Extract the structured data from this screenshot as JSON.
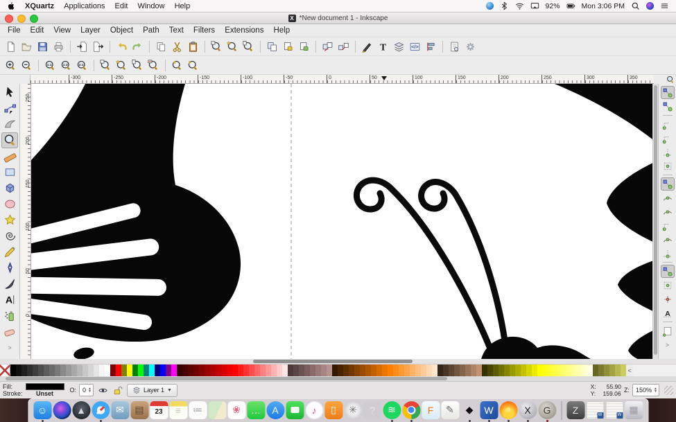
{
  "macos_menubar": {
    "app_name": "XQuartz",
    "items": [
      "Applications",
      "Edit",
      "Window",
      "Help"
    ],
    "status": {
      "battery_pct": "92%",
      "clock": "Mon 3:06 PM"
    },
    "status_icons": [
      {
        "type": "orb",
        "name": "helper-app-icon"
      },
      {
        "type": "svg",
        "icon": "bt",
        "name": "bluetooth-icon"
      },
      {
        "type": "svg",
        "icon": "wifi",
        "name": "wifi-icon"
      },
      {
        "type": "svg",
        "icon": "display",
        "name": "airplay-display-icon"
      },
      {
        "type": "text",
        "key": "battery_pct",
        "name": "battery-percent"
      },
      {
        "type": "svg",
        "icon": "battery",
        "name": "battery-icon"
      },
      {
        "type": "text",
        "key": "clock",
        "name": "menu-clock"
      },
      {
        "type": "svg",
        "icon": "search",
        "name": "spotlight-icon"
      },
      {
        "type": "siri",
        "name": "siri-icon"
      },
      {
        "type": "svg",
        "icon": "list",
        "name": "notification-center-icon"
      }
    ]
  },
  "window": {
    "title": "*New document 1 - Inkscape"
  },
  "menu": {
    "items": [
      "File",
      "Edit",
      "View",
      "Layer",
      "Object",
      "Path",
      "Text",
      "Filters",
      "Extensions",
      "Help"
    ]
  },
  "commands_toolbar": [
    {
      "name": "new-document",
      "icon": "doc-new"
    },
    {
      "name": "open-document",
      "icon": "folder-open"
    },
    {
      "name": "save-document",
      "icon": "save"
    },
    {
      "name": "print",
      "icon": "print"
    },
    {
      "sep": true
    },
    {
      "name": "import",
      "icon": "import"
    },
    {
      "name": "export",
      "icon": "export"
    },
    {
      "sep": true
    },
    {
      "name": "undo",
      "icon": "undo"
    },
    {
      "name": "redo",
      "icon": "redo"
    },
    {
      "sep": true
    },
    {
      "name": "copy",
      "icon": "copy"
    },
    {
      "name": "cut",
      "icon": "cut"
    },
    {
      "name": "paste",
      "icon": "paste"
    },
    {
      "sep": true
    },
    {
      "name": "zoom-to-selection",
      "icon": "zoom-sel"
    },
    {
      "name": "zoom-to-drawing",
      "icon": "zoom-draw"
    },
    {
      "name": "zoom-to-page",
      "icon": "zoom-page"
    },
    {
      "sep": true
    },
    {
      "name": "duplicate",
      "icon": "duplicate"
    },
    {
      "name": "create-clone",
      "icon": "clone"
    },
    {
      "name": "unlink-clone",
      "icon": "unlink-clone"
    },
    {
      "sep": true
    },
    {
      "name": "group-objects",
      "icon": "group"
    },
    {
      "name": "ungroup-objects",
      "icon": "ungroup"
    },
    {
      "sep": true
    },
    {
      "name": "fill-and-stroke-dialog",
      "icon": "fill-stroke"
    },
    {
      "name": "text-dialog",
      "icon": "text-dlg"
    },
    {
      "name": "layers-dialog",
      "icon": "layers"
    },
    {
      "name": "xml-editor",
      "icon": "xml"
    },
    {
      "name": "align-distribute-dialog",
      "icon": "align"
    },
    {
      "sep": true
    },
    {
      "name": "document-properties",
      "icon": "doc-props"
    },
    {
      "name": "preferences",
      "icon": "prefs"
    }
  ],
  "zoom_toolbar": [
    {
      "name": "zoom-in",
      "icon": "zoom-in"
    },
    {
      "name": "zoom-out",
      "icon": "zoom-out"
    },
    {
      "sep": true
    },
    {
      "name": "zoom-1-1",
      "icon": "z11"
    },
    {
      "name": "zoom-1-2",
      "icon": "z12"
    },
    {
      "name": "zoom-2-1",
      "icon": "z21"
    },
    {
      "sep": true
    },
    {
      "name": "zoom-to-selection",
      "icon": "zoom-sel"
    },
    {
      "name": "zoom-to-drawing",
      "icon": "zoom-draw"
    },
    {
      "name": "zoom-to-page",
      "icon": "zoom-page"
    },
    {
      "name": "zoom-page-width",
      "icon": "zoom-width"
    },
    {
      "sep": true
    },
    {
      "name": "zoom-previous",
      "icon": "zoom-prev"
    },
    {
      "name": "zoom-next",
      "icon": "zoom-next"
    }
  ],
  "toolbox": [
    {
      "name": "selector-tool",
      "icon": "tool-select"
    },
    {
      "name": "node-tool",
      "icon": "tool-node"
    },
    {
      "name": "tweak-tool",
      "icon": "tool-tweak"
    },
    {
      "name": "zoom-tool",
      "icon": "tool-zoom",
      "active": true
    },
    {
      "name": "measure-tool",
      "icon": "tool-measure"
    },
    {
      "name": "rectangle-tool",
      "icon": "tool-rect"
    },
    {
      "name": "box3d-tool",
      "icon": "tool-3dbox"
    },
    {
      "name": "ellipse-tool",
      "icon": "tool-ellipse"
    },
    {
      "name": "star-tool",
      "icon": "tool-star"
    },
    {
      "name": "spiral-tool",
      "icon": "tool-spiral"
    },
    {
      "name": "pencil-tool",
      "icon": "tool-pencil"
    },
    {
      "name": "bezier-tool",
      "icon": "tool-pen"
    },
    {
      "name": "calligraphy-tool",
      "icon": "tool-calligraphy"
    },
    {
      "name": "text-tool",
      "icon": "tool-text"
    },
    {
      "name": "spray-tool",
      "icon": "tool-spray"
    },
    {
      "name": "eraser-tool",
      "icon": "tool-eraser"
    },
    {
      "name": "toolbox-overflow",
      "text": ">"
    }
  ],
  "snapbar": [
    {
      "name": "snap-enabled",
      "icon": "snap-main",
      "active": true
    },
    {
      "name": "snap-bounding-box",
      "icon": "snap-main"
    },
    {
      "sep": true
    },
    {
      "name": "snap-bbox-edges",
      "icon": "snap-corner"
    },
    {
      "name": "snap-bbox-corners",
      "icon": "snap-corner"
    },
    {
      "name": "snap-bbox-edge-midpoints",
      "icon": "snap-mid"
    },
    {
      "name": "snap-bbox-centers",
      "icon": "snap-dot"
    },
    {
      "sep": true
    },
    {
      "name": "snap-nodes",
      "icon": "snap-main",
      "active": true
    },
    {
      "name": "snap-paths",
      "icon": "snap-path"
    },
    {
      "name": "snap-path-intersections",
      "icon": "snap-path"
    },
    {
      "name": "snap-cusp-nodes",
      "icon": "snap-corner"
    },
    {
      "name": "snap-smooth-nodes",
      "icon": "snap-path"
    },
    {
      "name": "snap-line-midpoints",
      "icon": "snap-mid"
    },
    {
      "sep": true
    },
    {
      "name": "snap-others",
      "icon": "snap-main",
      "active": true
    },
    {
      "name": "snap-object-centers",
      "icon": "snap-dot"
    },
    {
      "name": "snap-rotation-centers",
      "icon": "snap-plus"
    },
    {
      "name": "snap-text-baseline",
      "icon": "snap-text"
    },
    {
      "sep": true
    },
    {
      "name": "snap-page-border",
      "icon": "snap-page"
    },
    {
      "name": "snapbar-overflow",
      "text": ">"
    }
  ],
  "rulers": {
    "h_labels": [
      "-300",
      "-250",
      "-200",
      "-150",
      "-100",
      "-50",
      "0",
      "50",
      "100",
      "150",
      "200",
      "250",
      "300",
      "350"
    ],
    "v_labels": [
      "250",
      "200",
      "150",
      "100",
      "50",
      "0"
    ]
  },
  "palette": {
    "more_label": "<",
    "colors": [
      "#000000",
      "#0f0f0f",
      "#1f1f1f",
      "#2e2e2e",
      "#3d3d3d",
      "#4d4d4d",
      "#5c5c5c",
      "#6b6b6b",
      "#7a7a7a",
      "#8a8a8a",
      "#999999",
      "#a8a8a8",
      "#b8b8b8",
      "#c7c7c7",
      "#d6d6d6",
      "#e5e5e5",
      "#f5f5f5",
      "#ffffff",
      "#800000",
      "#ff0000",
      "#808000",
      "#ffff00",
      "#008000",
      "#00ff00",
      "#008080",
      "#00ffff",
      "#000080",
      "#0000ff",
      "#800080",
      "#ff00ff",
      "#330000",
      "#470000",
      "#5c0000",
      "#700000",
      "#850000",
      "#990000",
      "#ad0000",
      "#c20000",
      "#d60000",
      "#eb0000",
      "#ff0000",
      "#ff1a1a",
      "#ff3333",
      "#ff4d4d",
      "#ff6666",
      "#ff8080",
      "#ff9999",
      "#ffb3b3",
      "#ffcccc",
      "#ffe6e6",
      "#4d3939",
      "#5c4545",
      "#6b5252",
      "#7a5e5e",
      "#8a6b6b",
      "#997878",
      "#a88484",
      "#b89191",
      "#331900",
      "#472300",
      "#5c2e00",
      "#703800",
      "#854200",
      "#994d00",
      "#ad5700",
      "#c26100",
      "#d66c00",
      "#eb7600",
      "#ff8000",
      "#ff8d1a",
      "#ff9933",
      "#ffa64d",
      "#ffb366",
      "#ffc080",
      "#ffcc99",
      "#ffd9b3",
      "#ffe6cc",
      "#33261a",
      "#473626",
      "#5c4533",
      "#70553f",
      "#85644c",
      "#997359",
      "#ad8366",
      "#c29272",
      "#333300",
      "#474700",
      "#5c5c00",
      "#707000",
      "#858500",
      "#999900",
      "#adad00",
      "#c2c200",
      "#d6d600",
      "#ebeb00",
      "#ffff00",
      "#ffff1a",
      "#ffff33",
      "#ffff4d",
      "#ffff66",
      "#ffff80",
      "#ffff99",
      "#ffffb3",
      "#ffffcc",
      "#ffffe6",
      "#666622",
      "#7a7a2e",
      "#8f8f3a",
      "#a3a346",
      "#b8b852",
      "#cccc5e"
    ]
  },
  "statusbar": {
    "fill_label": "Fill:",
    "stroke_label": "Stroke:",
    "fill_color": "#000000",
    "stroke_value": "Unset",
    "opacity_label": "O:",
    "opacity_value": "0",
    "layer_name": "Layer 1",
    "x_label": "X:",
    "x_value": "55.90",
    "y_label": "Y:",
    "y_value": "159.06",
    "z_label": "Z:",
    "zoom_value": "150%"
  },
  "dock": [
    {
      "name": "finder",
      "glyph": "☺",
      "fg": "#ffffff",
      "bg": "linear-gradient(180deg,#58b7f5,#1d7fe3)",
      "r": "6px",
      "run": true
    },
    {
      "name": "siri",
      "glyph": "",
      "bg": "radial-gradient(circle at 42% 40%,#e060e0 0%,#7a4ae0 30%,#2a52c8 55%,#0a0c24 82%)",
      "r": "50%"
    },
    {
      "name": "launchpad",
      "glyph": "▲",
      "fg": "#d8dade",
      "bg": "radial-gradient(circle at 50% 40%,#5c646e,#23282e 75%)",
      "r": "50%"
    },
    {
      "name": "safari",
      "glyph": "",
      "cls": "dock-safari",
      "bg": "radial-gradient(circle,#f5f8fa 0 30%,#3fa9f5 32%)",
      "r": "50%",
      "run": true
    },
    {
      "name": "mail",
      "glyph": "✉",
      "fg": "#ffffff",
      "bg": "linear-gradient(180deg,#a8c8dc,#6f9cc0)",
      "r": "6px"
    },
    {
      "name": "contacts",
      "glyph": "▤",
      "fg": "#5a4330",
      "bg": "linear-gradient(180deg,#c9a27a,#9a734c)",
      "r": "6px"
    },
    {
      "name": "calendar",
      "glyph": "23",
      "cls": "dock-cal",
      "fg": "#222222",
      "bg": "#fbfbf9",
      "r": "5px"
    },
    {
      "name": "notes",
      "glyph": "≡",
      "fg": "#c9c5b4",
      "bg": "linear-gradient(180deg,#f2dc62 0 28%,#fdfdf7 28%)",
      "r": "5px"
    },
    {
      "name": "reminders",
      "glyph": "≔",
      "fg": "#9a9a9a",
      "bg": "#fcfcfc",
      "r": "6px"
    },
    {
      "name": "maps",
      "glyph": "",
      "bg": "linear-gradient(115deg,#d2e9c8 0 55%,#f3ead0 55%)",
      "r": "6px"
    },
    {
      "name": "photos",
      "glyph": "❀",
      "fg": "#e8657e",
      "bg": "#fdfdfd",
      "r": "6px"
    },
    {
      "name": "messages",
      "glyph": "…",
      "fg": "#ffffff",
      "bg": "linear-gradient(180deg,#6ae26a,#1fc93d)",
      "r": "6px"
    },
    {
      "name": "app-store",
      "glyph": "A",
      "fg": "#ffffff",
      "bg": "linear-gradient(180deg,#51aaf4,#1c7ce6)",
      "r": "50%"
    },
    {
      "name": "facetime",
      "glyph": "",
      "cls": "dock-ft",
      "bg": "linear-gradient(180deg,#4ce25c,#1db635)",
      "r": "6px"
    },
    {
      "name": "itunes",
      "glyph": "♪",
      "fg": "#e84a78",
      "bg": "radial-gradient(circle,#ffffff 0 62%,#ececf0 64%)",
      "r": "50%"
    },
    {
      "name": "ibooks",
      "glyph": "▯",
      "fg": "#ffffff",
      "bg": "linear-gradient(180deg,#ffa53e,#ef7d16)",
      "r": "6px"
    },
    {
      "name": "system-preferences",
      "glyph": "✳",
      "fg": "#73737b",
      "bg": "radial-gradient(circle,#ececee 0 40%,#b4b4bc)",
      "r": "50%"
    },
    {
      "name": "missing-app",
      "glyph": "?",
      "fg": "#e8e8ec",
      "bg": "rgba(200,200,210,0.35)",
      "r": "6px"
    },
    {
      "name": "spotify",
      "glyph": "≋",
      "fg": "#ffffff",
      "bg": "#1ed760",
      "r": "50%",
      "run": true
    },
    {
      "name": "chrome",
      "glyph": "",
      "cls": "dock-chrome",
      "bg": "conic-gradient(from -60deg,#ea4335 0deg 120deg,#34a853 120deg 240deg,#fbbc05 240deg 360deg)",
      "r": "50%",
      "run": true
    },
    {
      "name": "fusion-360",
      "glyph": "F",
      "fg": "#e87a1a",
      "bg": "linear-gradient(180deg,#f4fafd,#d8ecf6)",
      "r": "5px"
    },
    {
      "name": "textedit",
      "glyph": "✎",
      "fg": "#666666",
      "bg": "linear-gradient(180deg,#ffffff,#e8e8e4)",
      "r": "5px"
    },
    {
      "name": "inkscape",
      "glyph": "◆",
      "fg": "#0c0c0c",
      "bg": "transparent",
      "r": "0",
      "run": true
    },
    {
      "name": "word",
      "glyph": "W",
      "fg": "#ffffff",
      "bg": "linear-gradient(135deg,#3b71ca,#1d4b9c)",
      "r": "5px",
      "run": true
    },
    {
      "name": "hotspot-flame",
      "glyph": "",
      "cls": "dock-flame",
      "bg": "radial-gradient(circle at 50% 68%,#ffd83e 0 30%,#ff8d1e 62%,#ee5510)",
      "r": "50%",
      "run": true
    },
    {
      "name": "xquartz",
      "glyph": "X",
      "fg": "#16161a",
      "bg": "radial-gradient(circle at 38% 32%,#ececf0,#9c9ca4)",
      "r": "50%",
      "run": true
    },
    {
      "name": "gimp",
      "glyph": "G",
      "fg": "#3e3a34",
      "bg": "radial-gradient(circle at 42% 36%,#dcd8d0,#8e897e)",
      "r": "50%",
      "run": true,
      "runColor": "#7a1f1f"
    },
    {
      "divider": true
    },
    {
      "name": "zip-archive",
      "glyph": "Z",
      "fg": "#e0e0e0",
      "bg": "linear-gradient(180deg,#7c7c7c,#3c3c3c)",
      "r": "5px"
    },
    {
      "name": "minimized-document-1",
      "glyph": "",
      "cls": "dock-winthumb",
      "bg": "repeating-linear-gradient(180deg,#f7f6f3 0 3px,#e3e2de 3px 4px)",
      "r": "3px"
    },
    {
      "name": "minimized-document-2",
      "glyph": "",
      "cls": "dock-winthumb",
      "bg": "repeating-linear-gradient(180deg,#f7f6f3 0 3px,#e3e2de 3px 4px)",
      "r": "3px"
    },
    {
      "name": "trash",
      "glyph": "▦",
      "fg": "#9a9aa2",
      "bg": "linear-gradient(180deg,#f2f2f4,#b8b8c0)",
      "r": "4px"
    }
  ]
}
